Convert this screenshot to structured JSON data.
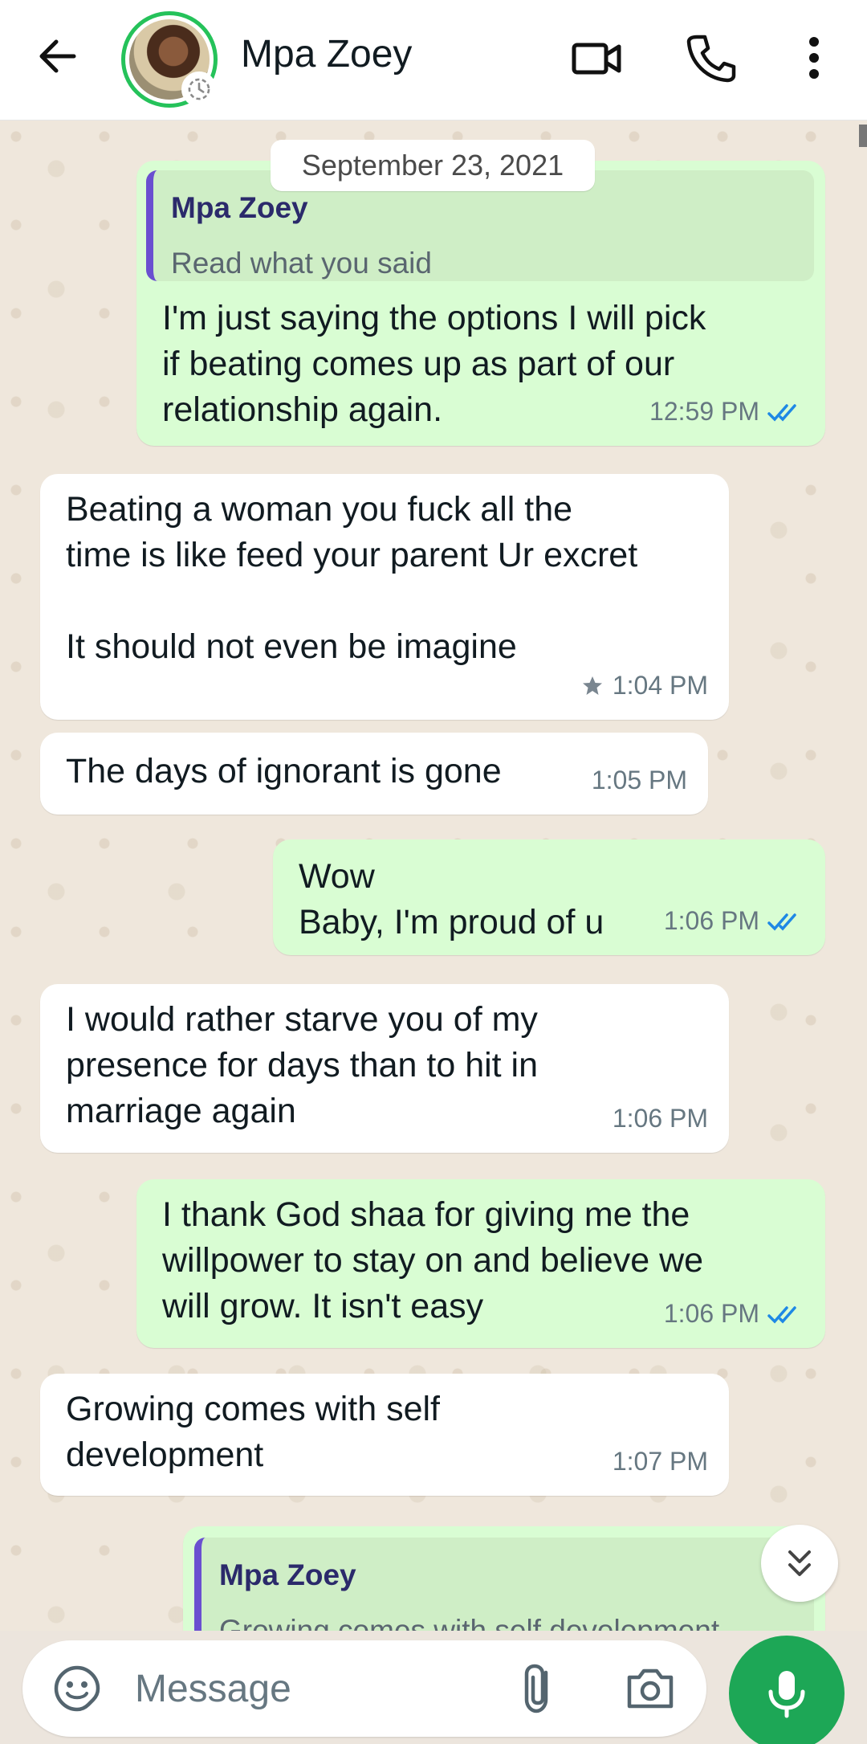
{
  "header": {
    "contact_name": "Mpa Zoey",
    "icons": [
      "back-arrow-icon",
      "video-call-icon",
      "voice-call-icon",
      "more-vert-icon"
    ]
  },
  "chat": {
    "date_chip": "September 23, 2021",
    "messages": [
      {
        "direction": "out",
        "quote": {
          "name": "Mpa Zoey",
          "text": "Read what you said"
        },
        "text": "I'm just saying the options I will pick\nif beating comes up as part of our\nrelationship again.",
        "time": "12:59 PM",
        "status": "read"
      },
      {
        "direction": "in",
        "text": "Beating a woman you fuck all the\ntime is like feed your parent Ur excret\n\nIt should not even be imagine",
        "time": "1:04 PM",
        "starred": true
      },
      {
        "direction": "in",
        "text": "The days of ignorant is gone",
        "time": "1:05 PM"
      },
      {
        "direction": "out",
        "text": "Wow\nBaby, I'm proud of u",
        "time": "1:06 PM",
        "status": "read"
      },
      {
        "direction": "in",
        "text": "I would rather starve you of my\npresence for days than to hit in\nmarriage again",
        "time": "1:06 PM"
      },
      {
        "direction": "out",
        "text": "I thank God shaa for giving me the\nwillpower to stay on and believe we\nwill grow. It isn't easy",
        "time": "1:06 PM",
        "status": "read"
      },
      {
        "direction": "in",
        "text": "Growing comes with self\ndevelopment",
        "time": "1:07 PM"
      },
      {
        "direction": "out",
        "quote": {
          "name": "Mpa Zoey",
          "text": "Growing comes with self development"
        },
        "partial": true
      }
    ]
  },
  "footer": {
    "placeholder": "Message"
  },
  "colors": {
    "outgoing_bubble": "#d9fdd3",
    "incoming_bubble": "#ffffff",
    "read_ticks": "#1e88e5",
    "accent_green": "#1da756",
    "quote_bar": "#6a4fd0"
  }
}
